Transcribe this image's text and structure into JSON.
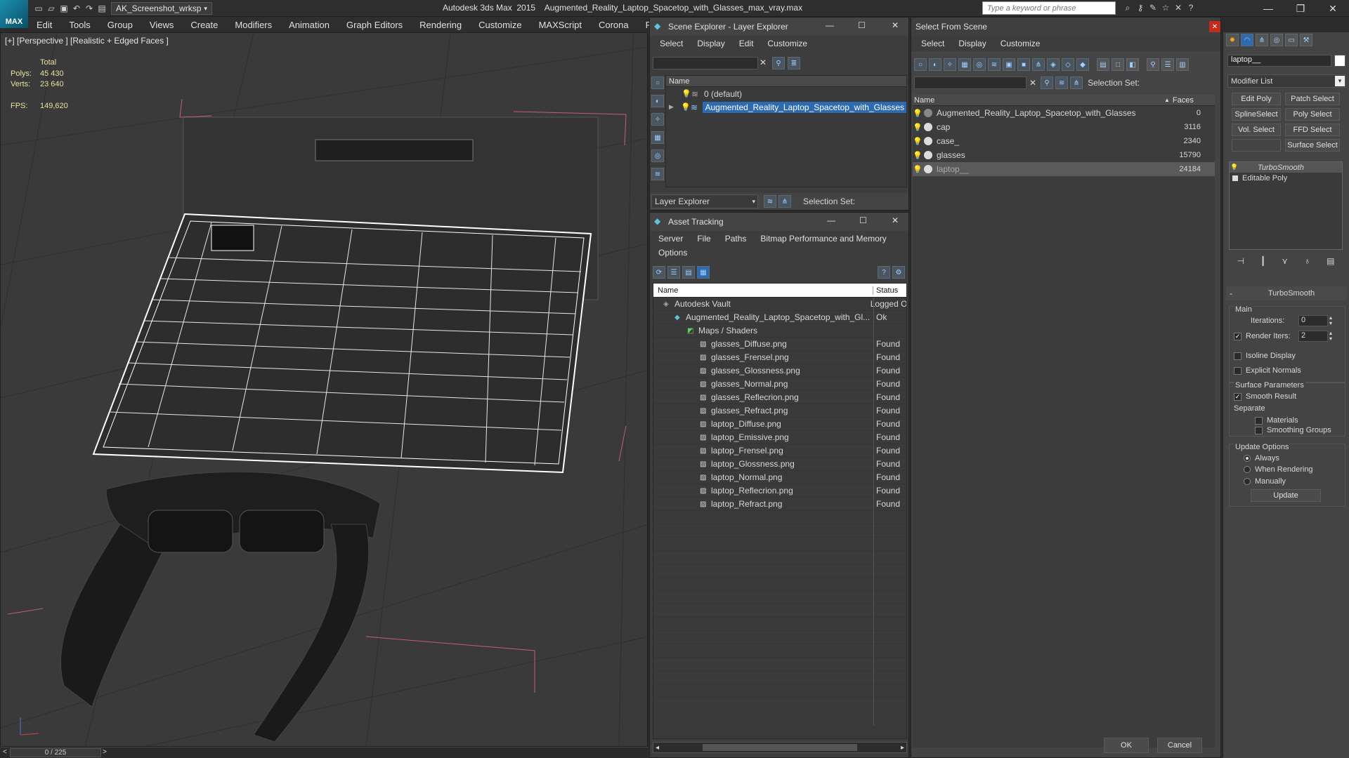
{
  "app": {
    "logo_text": "MAX",
    "workspace": "AK_Screenshot_wrksp",
    "title": "Autodesk 3ds Max  2015    Augmented_Reality_Laptop_Spacetop_with_Glasses_max_vray.max",
    "search_placeholder": "Type a keyword or phrase"
  },
  "menu": [
    "Edit",
    "Tools",
    "Group",
    "Views",
    "Create",
    "Modifiers",
    "Animation",
    "Graph Editors",
    "Rendering",
    "Customize",
    "MAXScript",
    "Corona",
    "Project Man"
  ],
  "viewport": {
    "label": "[+] [Perspective ] [Realistic + Edged Faces ]",
    "stats_header": "Total",
    "polys_label": "Polys:",
    "polys_value": "45 430",
    "verts_label": "Verts:",
    "verts_value": "23 640",
    "fps_label": "FPS:",
    "fps_value": "149,620"
  },
  "timeline": {
    "frame": "0 / 225"
  },
  "scene_explorer": {
    "title": "Scene Explorer - Layer Explorer",
    "menu": [
      "Select",
      "Display",
      "Edit",
      "Customize"
    ],
    "col_name": "Name",
    "rows": [
      "0 (default)",
      "Augmented_Reality_Laptop_Spacetop_with_Glasses"
    ],
    "footer_label": "Layer Explorer",
    "selection_set": "Selection Set:"
  },
  "asset_tracking": {
    "title": "Asset Tracking",
    "menu": [
      "Server",
      "File",
      "Paths",
      "Bitmap Performance and Memory"
    ],
    "menu2": "Options",
    "col_name": "Name",
    "col_status": "Status",
    "rows": [
      {
        "name": "Autodesk Vault",
        "status": "Logged O"
      },
      {
        "name": "Augmented_Reality_Laptop_Spacetop_with_Gl...",
        "status": "Ok"
      },
      {
        "name": "Maps / Shaders",
        "status": ""
      },
      {
        "name": "glasses_Diffuse.png",
        "status": "Found"
      },
      {
        "name": "glasses_Frensel.png",
        "status": "Found"
      },
      {
        "name": "glasses_Glossness.png",
        "status": "Found"
      },
      {
        "name": "glasses_Normal.png",
        "status": "Found"
      },
      {
        "name": "glasses_Reflecrion.png",
        "status": "Found"
      },
      {
        "name": "glasses_Refract.png",
        "status": "Found"
      },
      {
        "name": "laptop_Diffuse.png",
        "status": "Found"
      },
      {
        "name": "laptop_Emissive.png",
        "status": "Found"
      },
      {
        "name": "laptop_Frensel.png",
        "status": "Found"
      },
      {
        "name": "laptop_Glossness.png",
        "status": "Found"
      },
      {
        "name": "laptop_Normal.png",
        "status": "Found"
      },
      {
        "name": "laptop_Reflecrion.png",
        "status": "Found"
      },
      {
        "name": "laptop_Refract.png",
        "status": "Found"
      }
    ]
  },
  "select_from_scene": {
    "title": "Select From Scene",
    "menu": [
      "Select",
      "Display",
      "Customize"
    ],
    "selection_set": "Selection Set:",
    "col_name": "Name",
    "col_faces": "Faces",
    "rows": [
      {
        "name": "Augmented_Reality_Laptop_Spacetop_with_Glasses",
        "faces": "0"
      },
      {
        "name": "cap",
        "faces": "3116"
      },
      {
        "name": "case_",
        "faces": "2340"
      },
      {
        "name": "glasses",
        "faces": "15790"
      },
      {
        "name": "laptop__",
        "faces": "24184"
      }
    ],
    "ok": "OK",
    "cancel": "Cancel"
  },
  "command_panel": {
    "object_name": "laptop__",
    "modifier_list": "Modifier List",
    "buttons": [
      "Edit Poly",
      "Patch Select",
      "SplineSelect",
      "Poly Select",
      "Vol. Select",
      "FFD Select",
      "Surface Select"
    ],
    "stack": [
      "TurboSmooth",
      "Editable Poly"
    ],
    "rollout_title": "TurboSmooth",
    "main_label": "Main",
    "iterations_label": "Iterations:",
    "iterations_value": "0",
    "render_iters_label": "Render Iters:",
    "render_iters_value": "2",
    "isoline": "Isoline Display",
    "explicit": "Explicit Normals",
    "surface_params": "Surface Parameters",
    "smooth_result": "Smooth Result",
    "separate": "Separate",
    "materials": "Materials",
    "smoothing_groups": "Smoothing Groups",
    "update_options": "Update Options",
    "always": "Always",
    "when_rendering": "When Rendering",
    "manually": "Manually",
    "update_btn": "Update"
  }
}
